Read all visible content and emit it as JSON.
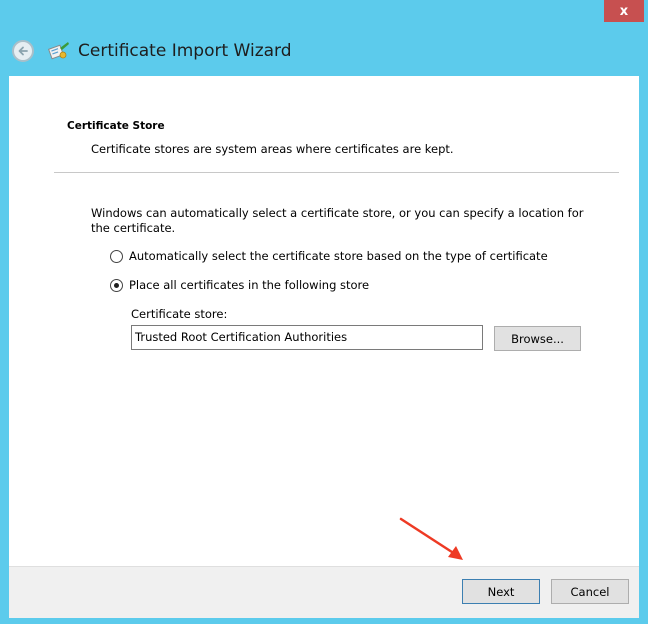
{
  "window": {
    "title": "Certificate Import Wizard",
    "close_label": "x"
  },
  "icons": {
    "back": "back-arrow-icon",
    "wizard": "certificate-wizard-icon"
  },
  "section": {
    "heading": "Certificate Store",
    "description": "Certificate stores are system areas where certificates are kept."
  },
  "intro_text": "Windows can automatically select a certificate store, or you can specify a location for the certificate.",
  "options": [
    {
      "label": "Automatically select the certificate store based on the type of certificate",
      "selected": false
    },
    {
      "label": "Place all certificates in the following store",
      "selected": true
    }
  ],
  "store": {
    "label": "Certificate store:",
    "value": "Trusted Root Certification Authorities",
    "browse_label": "Browse..."
  },
  "footer": {
    "next_label": "Next",
    "cancel_label": "Cancel"
  },
  "colors": {
    "frame": "#5ccbec",
    "close": "#c75050",
    "annotation_arrow": "#ee3a24"
  }
}
